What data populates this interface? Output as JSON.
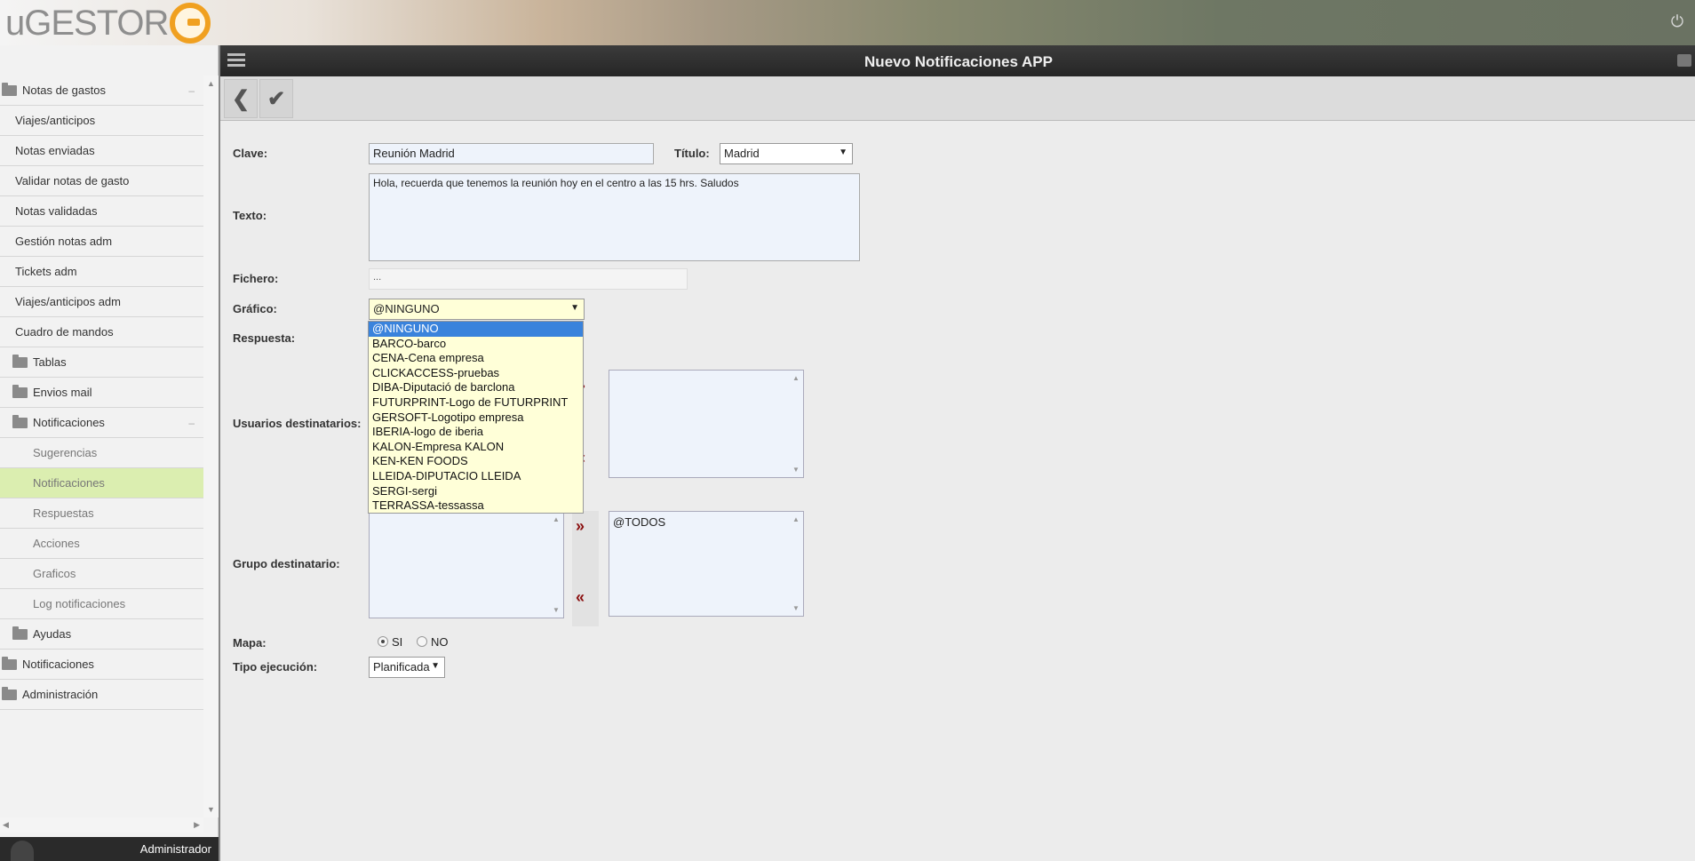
{
  "app": {
    "logo_text": "uGESTOR"
  },
  "sidebar": {
    "items": [
      {
        "label": "Notas de gastos",
        "level": 1,
        "folder": true,
        "collapse": "–"
      },
      {
        "label": "Viajes/anticipos",
        "level": 2
      },
      {
        "label": "Notas enviadas",
        "level": 2
      },
      {
        "label": "Validar notas de gasto",
        "level": 2
      },
      {
        "label": "Notas validadas",
        "level": 2
      },
      {
        "label": "Gestión notas adm",
        "level": 2
      },
      {
        "label": "Tickets adm",
        "level": 2
      },
      {
        "label": "Viajes/anticipos adm",
        "level": 2
      },
      {
        "label": "Cuadro de mandos",
        "level": 2
      },
      {
        "label": "Tablas",
        "level": 2,
        "folder": true
      },
      {
        "label": "Envios mail",
        "level": 2,
        "folder": true
      },
      {
        "label": "Notificaciones",
        "level": 2,
        "folder": true,
        "collapse": "–"
      },
      {
        "label": "Sugerencias",
        "level": 3
      },
      {
        "label": "Notificaciones",
        "level": 3,
        "active": true
      },
      {
        "label": "Respuestas",
        "level": 3
      },
      {
        "label": "Acciones",
        "level": 3
      },
      {
        "label": "Graficos",
        "level": 3
      },
      {
        "label": "Log notificaciones",
        "level": 3
      },
      {
        "label": "Ayudas",
        "level": 2,
        "folder": true
      },
      {
        "label": "Notificaciones",
        "level": 1,
        "folder": true
      },
      {
        "label": "Administración",
        "level": 1,
        "folder": true
      }
    ],
    "user": "Administrador"
  },
  "header": {
    "title": "Nuevo Notificaciones APP"
  },
  "form": {
    "clave_label": "Clave:",
    "clave_value": "Reunión Madrid",
    "titulo_label": "Título:",
    "titulo_value": "Madrid",
    "texto_label": "Texto:",
    "texto_value": "Hola, recuerda que tenemos la reunión hoy en el centro a las 15 hrs. Saludos",
    "fichero_label": "Fichero:",
    "fichero_value": "...",
    "grafico_label": "Gráfico:",
    "grafico_value": "@NINGUNO",
    "respuesta_label": "Respuesta:",
    "usuarios_label": "Usuarios destinatarios:",
    "grupo_label": "Grupo destinatario:",
    "grupo_selected": "@TODOS",
    "mapa_label": "Mapa:",
    "mapa_si": "SI",
    "mapa_no": "NO",
    "tipo_label": "Tipo ejecución:",
    "tipo_value": "Planificada"
  },
  "grafico_options": [
    "@NINGUNO",
    "BARCO-barco",
    "CENA-Cena empresa",
    "CLICKACCESS-pruebas",
    "DIBA-Diputació de barclona",
    "FUTURPRINT-Logo de FUTURPRINT",
    "GERSOFT-Logotipo empresa",
    "IBERIA-logo de iberia",
    "KALON-Empresa KALON",
    "KEN-KEN FOODS",
    "LLEIDA-DIPUTACIO LLEIDA",
    "SERGI-sergi",
    "TERRASSA-tessassa"
  ],
  "colors": {
    "active_item": "#dbeeb0",
    "dropdown_bg": "#ffffd8",
    "selected_option": "#3a83dc",
    "move_arrows": "#8b1010"
  }
}
